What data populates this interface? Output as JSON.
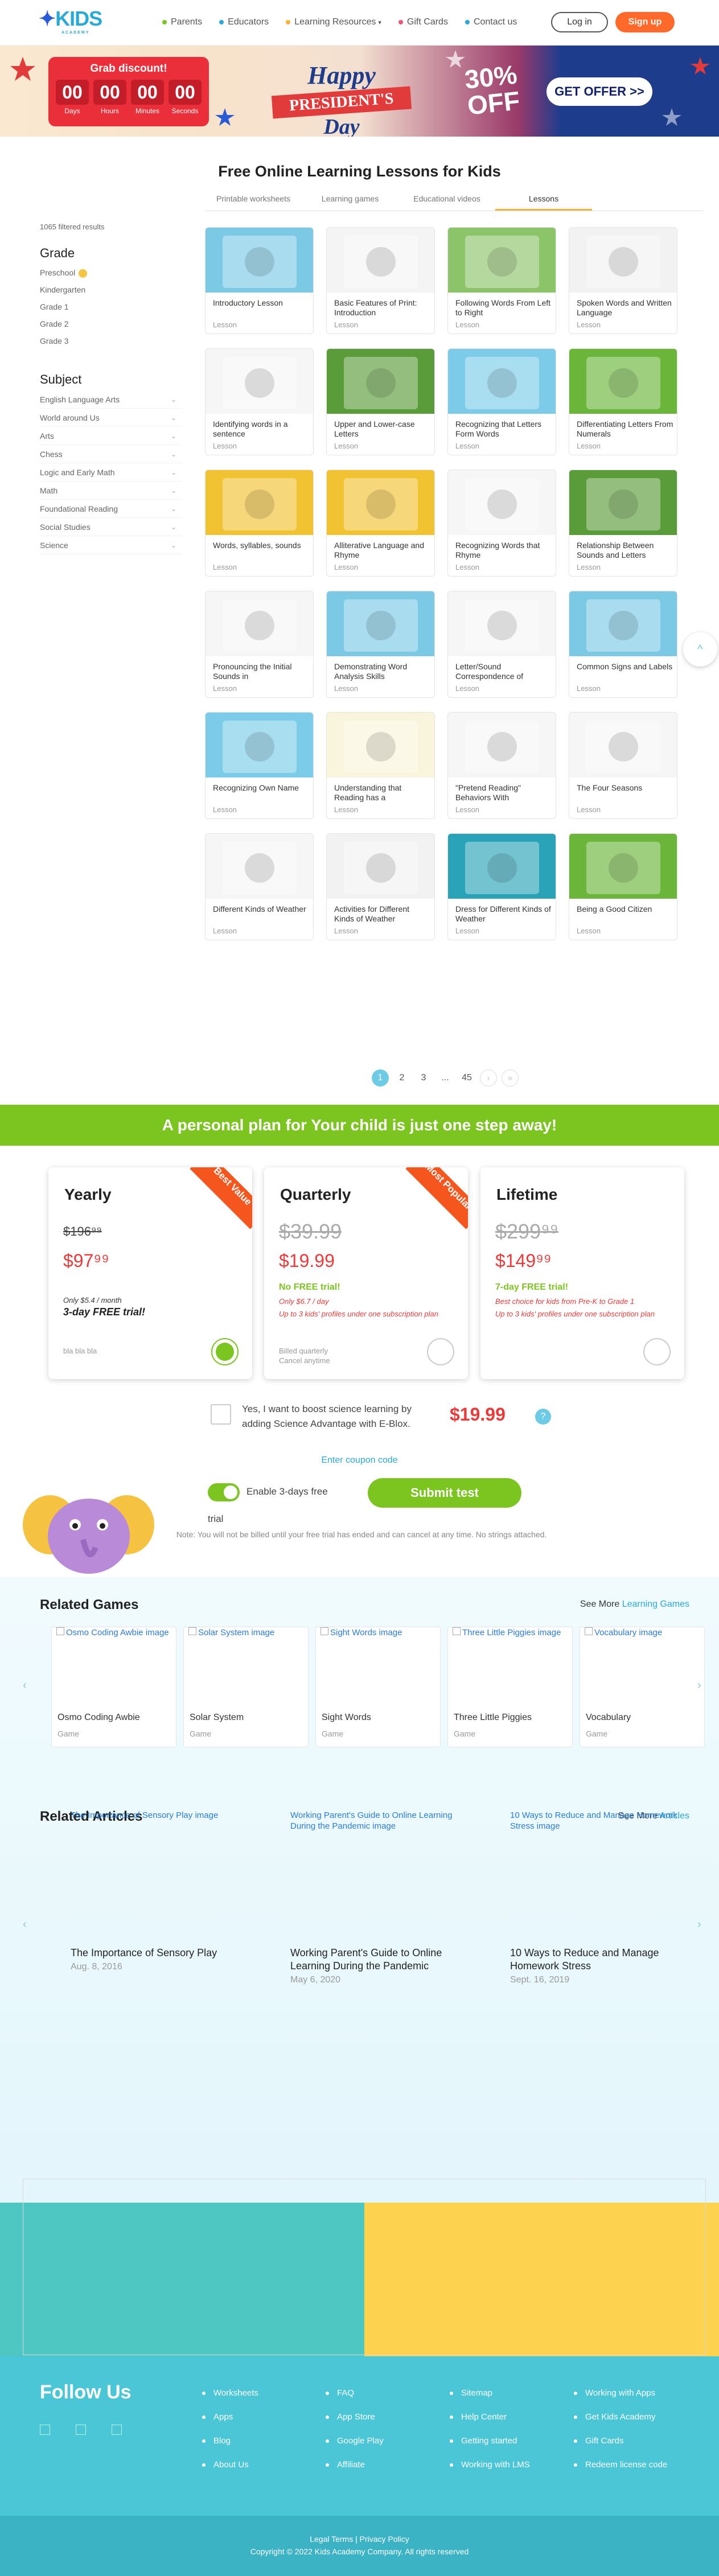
{
  "header": {
    "logo_text": "KIDS",
    "logo_sub": "ACADEMY",
    "nav": [
      {
        "label": "Parents",
        "color": "#7cc521"
      },
      {
        "label": "Educators",
        "color": "#29a9d6"
      },
      {
        "label": "Learning Resources",
        "color": "#f6b23a",
        "chevron": "▾"
      },
      {
        "label": "Gift Cards",
        "color": "#e9567a"
      },
      {
        "label": "Contact us",
        "color": "#29a9d6"
      }
    ],
    "login": "Log in",
    "signup": "Sign up"
  },
  "banner": {
    "grab": "Grab discount!",
    "timer": [
      {
        "value": "00",
        "unit": "Days"
      },
      {
        "value": "00",
        "unit": "Hours"
      },
      {
        "value": "00",
        "unit": "Minutes"
      },
      {
        "value": "00",
        "unit": "Seconds"
      }
    ],
    "headline_top": "Happy",
    "headline_ribbon": "PRESIDENT'S",
    "headline_bottom": "Day",
    "discount": "30%",
    "discount_sub": "OFF",
    "cta": "GET OFFER >>"
  },
  "lessons": {
    "title": "Free Online Learning Lessons for Kids",
    "tabs": [
      "Printable worksheets",
      "Learning games",
      "Educational videos",
      "Lessons"
    ],
    "active_tab": "Lessons",
    "filtered": "1065 filtered results",
    "grade_heading": "Grade",
    "grades": [
      "Preschool",
      "Kindergarten",
      "Grade 1",
      "Grade 2",
      "Grade 3"
    ],
    "subject_heading": "Subject",
    "subjects": [
      "English Language Arts",
      "World around Us",
      "Arts",
      "Chess",
      "Logic and Early Math",
      "Math",
      "Foundational Reading",
      "Social Studies",
      "Science"
    ],
    "cards": [
      {
        "name": "Introductory Lesson",
        "type": "Lesson",
        "bg": "#7cc9e6"
      },
      {
        "name": "Basic Features of Print: Introduction",
        "type": "Lesson",
        "bg": "#f4f4f4"
      },
      {
        "name": "Following Words From Left to Right",
        "type": "Lesson",
        "bg": "#8cc46a"
      },
      {
        "name": "Spoken Words and Written Language",
        "type": "Lesson",
        "bg": "#f2f2f2"
      },
      {
        "name": "Identifying words in a sentence",
        "type": "Lesson",
        "bg": "#f6f6f6"
      },
      {
        "name": "Upper and Lower-case Letters",
        "type": "Lesson",
        "bg": "#5a9c3a"
      },
      {
        "name": "Recognizing that Letters Form Words",
        "type": "Lesson",
        "bg": "#7ccbe8"
      },
      {
        "name": "Differentiating Letters From Numerals",
        "type": "Lesson",
        "bg": "#6ab53a"
      },
      {
        "name": "Words, syllables, sounds",
        "type": "Lesson",
        "bg": "#f1c232"
      },
      {
        "name": "Alliterative Language and Rhyme",
        "type": "Lesson",
        "bg": "#f1c232"
      },
      {
        "name": "Recognizing Words that Rhyme",
        "type": "Lesson",
        "bg": "#f6f6f6"
      },
      {
        "name": "Relationship Between Sounds and Letters",
        "type": "Lesson",
        "bg": "#5a9c3a"
      },
      {
        "name": "Pronouncing the Initial Sounds in",
        "type": "Lesson",
        "bg": "#f6f6f6"
      },
      {
        "name": "Demonstrating Word Analysis Skills",
        "type": "Lesson",
        "bg": "#7cc9e6"
      },
      {
        "name": "Letter/Sound Correspondence of",
        "type": "Lesson",
        "bg": "#f6f6f6"
      },
      {
        "name": "Common Signs and Labels",
        "type": "Lesson",
        "bg": "#7cc9e6"
      },
      {
        "name": "Recognizing Own Name",
        "type": "Lesson",
        "bg": "#7ccbe8"
      },
      {
        "name": "Understanding that Reading has a",
        "type": "Lesson",
        "bg": "#f9f4dc"
      },
      {
        "name": "\"Pretend Reading\" Behaviors With",
        "type": "Lesson",
        "bg": "#f6f6f6"
      },
      {
        "name": "The Four Seasons",
        "type": "Lesson",
        "bg": "#f6f6f6"
      },
      {
        "name": "Different Kinds of Weather",
        "type": "Lesson",
        "bg": "#f6f6f6"
      },
      {
        "name": "Activities for Different Kinds of Weather",
        "type": "Lesson",
        "bg": "#f2f2f2"
      },
      {
        "name": "Dress for Different Kinds of Weather",
        "type": "Lesson",
        "bg": "#2aa3b8"
      },
      {
        "name": "Being a Good Citizen",
        "type": "Lesson",
        "bg": "#6ab53a"
      }
    ],
    "pagination": [
      "1",
      "2",
      "3",
      "...",
      "45"
    ],
    "next_icon": "›",
    "last_icon": "»",
    "scroll_up_icon": "^"
  },
  "plans": {
    "banner": "A personal plan for Your child is just one step away!",
    "items": [
      {
        "name": "Yearly",
        "old": "$196⁹⁹",
        "new": "$97⁹⁹",
        "corner": "Best Value",
        "l1": "",
        "l2": "",
        "l3": "",
        "month": "Only $5.4 / month",
        "free": "3-day FREE trial!",
        "grey": "bla bla bla",
        "selected": true
      },
      {
        "name": "Quarterly",
        "old": "$39.99",
        "new": "$19.99",
        "corner": "Most Popular",
        "l1": "No FREE trial!",
        "l2": "Only $6.7 / day",
        "l3": "Up to 3 kids' profiles under one subscription plan",
        "month": "",
        "free": "",
        "grey": "Billed quarterly\nCancel anytime",
        "selected": false
      },
      {
        "name": "Lifetime",
        "old": "$299⁹⁹",
        "new": "$149⁹⁹",
        "corner": "",
        "l1": "7-day FREE trial!",
        "l2": "Best choice for kids from Pre-K to Grade 1",
        "l3": "Up to 3 kids' profiles under one subscription plan",
        "month": "",
        "free": "",
        "grey": "",
        "selected": false
      }
    ],
    "science_text": "Yes, I want to boost science learning by adding Science Advantage with E-Blox.",
    "science_price": "$19.99",
    "help_icon": "?",
    "coupon": "Enter coupon code",
    "trial": "Enable 3-days free trial",
    "submit": "Submit test",
    "note": "Note: You will not be billed until your free trial has ended and can cancel at any time. No strings attached."
  },
  "related_games": {
    "title": "Related Games",
    "see_more": "See More",
    "see_more_link": "Learning Games",
    "items": [
      {
        "alt": "Osmo Coding Awbie image",
        "name": "Osmo Coding Awbie",
        "type": "Game"
      },
      {
        "alt": "Solar System image",
        "name": "Solar System",
        "type": "Game"
      },
      {
        "alt": "Sight Words image",
        "name": "Sight Words",
        "type": "Game"
      },
      {
        "alt": "Three Little Piggies image",
        "name": "Three Little Piggies",
        "type": "Game"
      },
      {
        "alt": "Vocabulary image",
        "name": "Vocabulary",
        "type": "Game"
      }
    ]
  },
  "related_articles": {
    "title": "Related Articles",
    "see_more": "See More",
    "see_more_link": "Articles",
    "items": [
      {
        "alt": "The Importance of Sensory Play image",
        "title": "The Importance of Sensory Play",
        "date": "Aug. 8, 2016"
      },
      {
        "alt": "Working Parent's Guide to Online Learning During the Pandemic image",
        "title": "Working Parent's Guide to Online Learning During the Pandemic",
        "date": "May 6, 2020"
      },
      {
        "alt": "10 Ways to Reduce and Manage Homework Stress image",
        "title": "10 Ways to Reduce and Manage Homework Stress",
        "date": "Sept. 16, 2019"
      }
    ]
  },
  "footer": {
    "follow": "Follow Us",
    "col1": [
      "Worksheets",
      "Apps",
      "Blog",
      "About Us"
    ],
    "col2": [
      "FAQ",
      "App Store",
      "Google Play",
      "Affiliate"
    ],
    "col3": [
      "Sitemap",
      "Help Center",
      "Getting started",
      "Working with LMS"
    ],
    "col4": [
      "Working with Apps",
      "Get Kids Academy",
      "Gift Cards",
      "Redeem license code"
    ],
    "legal": "Legal Terms | Privacy Policy",
    "copyright": "Copyright © 2022 Kids Academy Company. All rights reserved"
  }
}
